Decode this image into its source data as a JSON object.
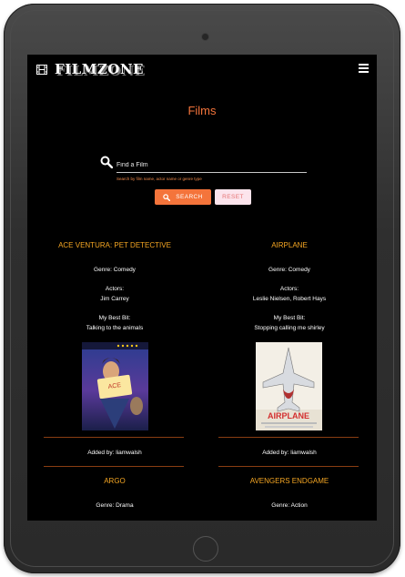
{
  "app": {
    "brand": "FILMZONE",
    "page_title": "Films"
  },
  "nav": {
    "logo_icon": "film-strip-icon",
    "menu_icon": "hamburger-menu-icon"
  },
  "search": {
    "placeholder": "Find a Film",
    "helper": "Search by film name, actor name or genre type",
    "search_label": "SEARCH",
    "reset_label": "RESET"
  },
  "films": [
    {
      "title": "ACE VENTURA: PET DETECTIVE",
      "genre": "Genre: Comedy",
      "actors_label": "Actors:",
      "actors": "Jim Carrey",
      "best_bit_label": "My Best Bit:",
      "best_bit": "Talking to the animals",
      "added_by": "Added by: liamwalsh"
    },
    {
      "title": "AIRPLANE",
      "genre": "Genre: Comedy",
      "actors_label": "Actors:",
      "actors": "Leslie Nielsen, Robert Hays",
      "best_bit_label": "My Best Bit:",
      "best_bit": "Stopping calling me shirley",
      "added_by": "Added by: liamwalsh"
    },
    {
      "title": "ARGO",
      "genre": "Genre: Drama"
    },
    {
      "title": "AVENGERS ENDGAME",
      "genre": "Genre: Action"
    }
  ],
  "colors": {
    "accent": "#f4743b",
    "card_title": "#f5a623",
    "background": "#000000",
    "reset_bg": "#fce4ec"
  }
}
